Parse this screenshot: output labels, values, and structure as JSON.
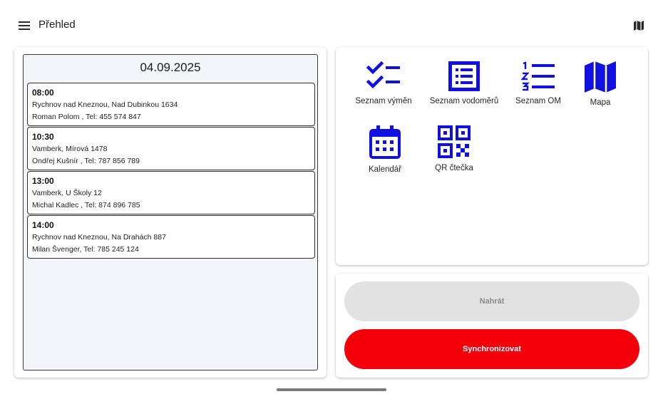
{
  "appbar": {
    "title": "Přehled",
    "menu_icon": "hamburger-menu-icon",
    "map_icon": "map-icon"
  },
  "schedule": {
    "date": "04.09.2025",
    "appointments": [
      {
        "time": "08:00",
        "address": "Rychnov nad Kneznou, Nad Dubinkou 1634",
        "contact": "Roman Polom , Tel: 455 574 847"
      },
      {
        "time": "10:30",
        "address": "Vamberk, Mírová 1478",
        "contact": "Ondřej Kušnír , Tel: 787 856 789"
      },
      {
        "time": "13:00",
        "address": "Vamberk, U Školy 12",
        "contact": "Michal Kadlec , Tel: 874 896 785"
      },
      {
        "time": "14:00",
        "address": "Rychnov nad Kneznou, Na Drahách 887",
        "contact": " Milan Švenger, Tel: 785 245 124"
      }
    ]
  },
  "menu": {
    "icon_color": "#1010e0",
    "tiles": [
      {
        "label": "Seznam výměn",
        "icon": "checklist-icon"
      },
      {
        "label": "Seznam vodoměrů",
        "icon": "list-document-icon"
      },
      {
        "label": "Seznam OM",
        "icon": "numbered-list-icon"
      },
      {
        "label": "Mapa",
        "icon": "map-icon"
      },
      {
        "label": "Kalendář",
        "icon": "calendar-icon"
      },
      {
        "label": "QR čtečka",
        "icon": "qr-code-icon"
      }
    ]
  },
  "actions": {
    "upload_label": "Nahrát",
    "sync_label": "Synchronizovat",
    "sync_color": "#f3000a",
    "upload_color": "#e2e2e2"
  }
}
